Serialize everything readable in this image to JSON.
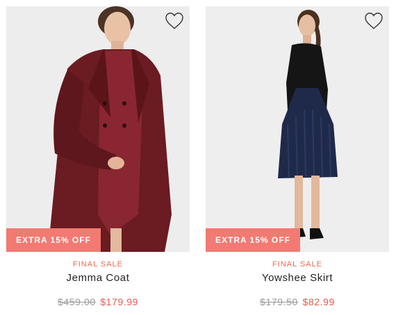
{
  "colors": {
    "promo_bg": "#f27a72",
    "final_sale": "#e86a4e",
    "sale_price": "#e8574e",
    "old_price": "#9a9a9a",
    "photo_bg": "#ececec"
  },
  "products": [
    {
      "promo_badge": "EXTRA 15% OFF",
      "final_sale_label": "FINAL SALE",
      "name": "Jemma Coat",
      "original_price": "$459.00",
      "sale_price": "$179.99",
      "wishlist_icon": "heart-outline-icon"
    },
    {
      "promo_badge": "EXTRA 15% OFF",
      "final_sale_label": "FINAL SALE",
      "name": "Yowshee Skirt",
      "original_price": "$179.50",
      "sale_price": "$82.99",
      "wishlist_icon": "heart-outline-icon"
    }
  ]
}
